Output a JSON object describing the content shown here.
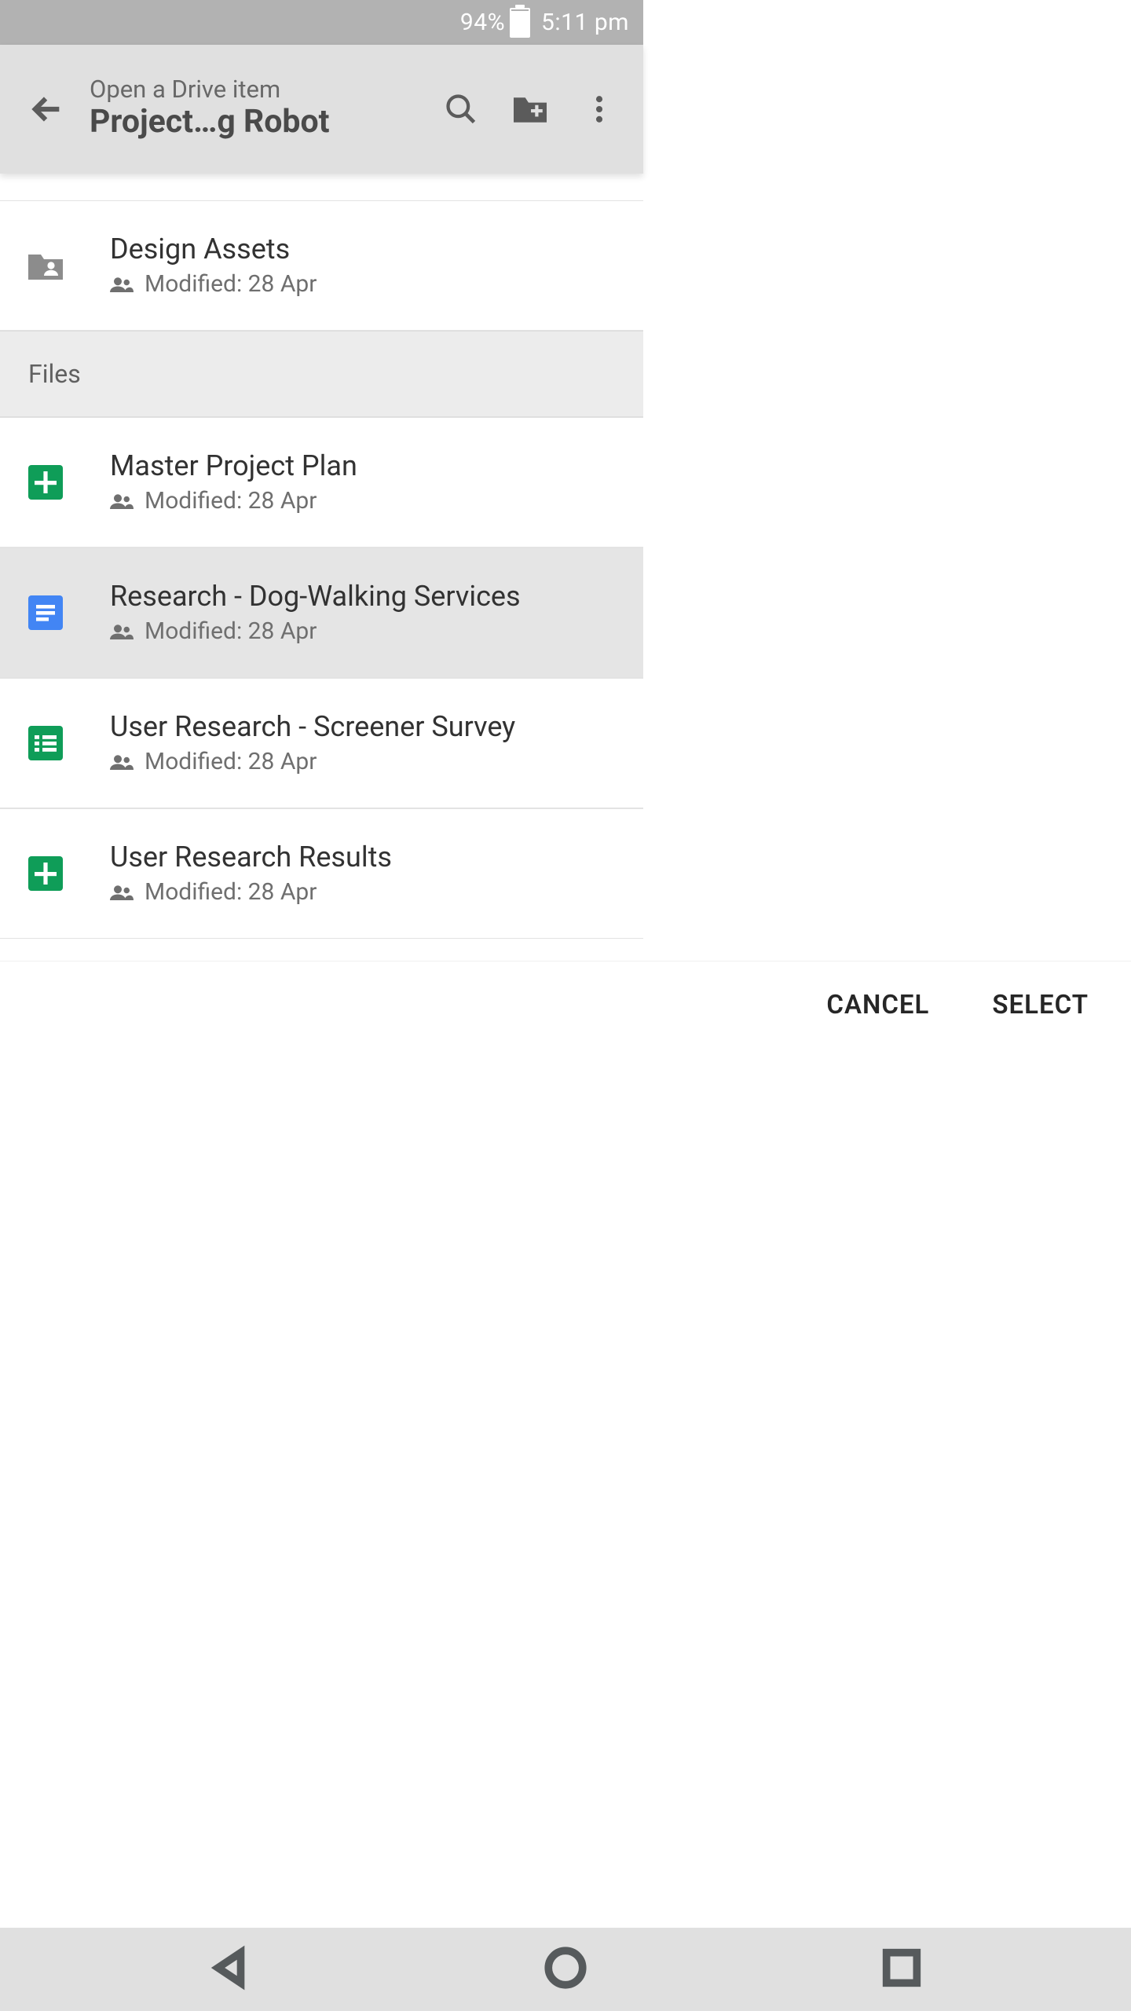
{
  "statusbar": {
    "battery_pct": "94%",
    "time": "5:11 pm"
  },
  "appbar": {
    "subtitle": "Open a Drive item",
    "title": "Project…g Robot"
  },
  "folders": [
    {
      "name": "Design Assets",
      "modified": "Modified: 28 Apr",
      "icon": "folder-shared",
      "shared": true
    }
  ],
  "files_header": "Files",
  "files": [
    {
      "name": "Master Project Plan",
      "modified": "Modified: 28 Apr",
      "icon": "sheets-plus",
      "shared": true,
      "selected": false
    },
    {
      "name": "Research - Dog-Walking Services",
      "modified": "Modified: 28 Apr",
      "icon": "docs",
      "shared": true,
      "selected": true
    },
    {
      "name": "User Research - Screener Survey",
      "modified": "Modified: 28 Apr",
      "icon": "forms",
      "shared": true,
      "selected": false
    },
    {
      "name": "User Research Results",
      "modified": "Modified: 28 Apr",
      "icon": "sheets-plus",
      "shared": true,
      "selected": false
    }
  ],
  "footer": {
    "cancel": "CANCEL",
    "select": "SELECT"
  }
}
